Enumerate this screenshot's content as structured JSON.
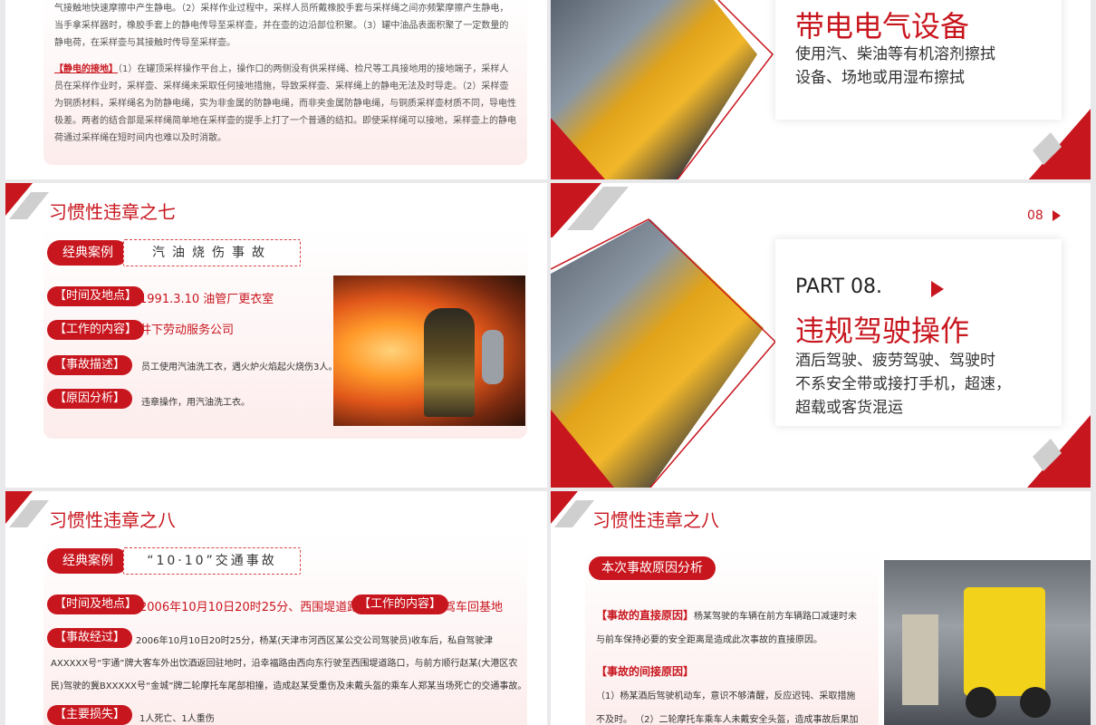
{
  "slide_tl": {
    "para1": "气接触地快速摩擦中产生静电。（2）采样作业过程中，采样人员所戴橡胶手套与采样绳之间亦频繁摩擦产生静电，当手拿采样器时，橡胶手套上的静电传导至采样壶，并在壶的边沿部位积聚。（3）罐中油品表面积聚了一定数量的静电荷，在采样壶与其接触时传导至采样壶。",
    "para2_label": "【静电的接地】",
    "para2": "（1）在罐顶采样操作平台上，操作口的两侧没有供采样绳、检尺等工具接地用的接地端子，采样人员在采样作业时，采样壶、采样绳未采取任何接地措施，导致采样壶、采样绳上的静电无法及时导走。（2）采样壶为铜质材料，采样绳名为防静电绳，实为非金属的防静电绳，而非夹金属防静电绳，与铜质采样壶材质不同，导电性极差。两者的结合部是采样绳简单地在采样壶的提手上打了一个普通的结扣。即使采样绳可以接地，采样壶上的静电荷通过采样绳在短时间内也难以及时消散。"
  },
  "slide_tr": {
    "heading": "带电电气设备",
    "line1": "使用汽、柴油等有机溶剂擦拭",
    "line2": "设备、场地或用湿布擦拭"
  },
  "slide_ml": {
    "title": "习惯性违章之七",
    "case_pill": "经典案例",
    "case_name": "汽油烧伤事故",
    "rows": [
      {
        "label": "【时间及地点】",
        "value": "1991.3.10  油管厂更衣室"
      },
      {
        "label": "【工作的内容】",
        "value": "井下劳动服务公司"
      },
      {
        "label": "【事故描述】",
        "value": "员工使用汽油洗工衣，遇火炉火焰起火烧伤3人。"
      },
      {
        "label": "【原因分析】",
        "value": "违章操作，用汽油洗工衣。"
      }
    ]
  },
  "slide_mr": {
    "page_num": "08",
    "part": "PART 08.",
    "heading": "违规驾驶操作",
    "line1": "酒后驾驶、疲劳驾驶、驾驶时",
    "line2": "不系安全带或接打手机，超速，",
    "line3": "超载或客货混运"
  },
  "slide_bl": {
    "title": "习惯性违章之八",
    "case_pill": "经典案例",
    "case_name": "“10·10”交通事故",
    "time_label": "【时间及地点】",
    "time_value": "2006年10月10日20时25分、西围堤道路口",
    "work_label": "【工作的内容】",
    "work_value": "驾车回基地",
    "process_label": "【事故经过】",
    "process_text": "2006年10月10日20时25分，杨某(天津市河西区某公交公司驾驶员)收车后，私自驾驶津AXXXXX号“宇通”牌大客车外出饮酒返回驻地时，沿幸福路由西向东行驶至西围堤道路口，与前方顺行赵某(大港区农民)驾驶的冀BXXXXX号“金城”牌二轮摩托车尾部相撞，造成赵某受重伤及未戴头盔的乘车人郑某当场死亡的交通事故。",
    "loss_label": "【主要损失】",
    "loss_value": "1人死亡、1人重伤"
  },
  "slide_br": {
    "title": "习惯性违章之八",
    "pill": "本次事故原因分析",
    "direct_label": "【事故的直接原因】",
    "direct_text": "杨某驾驶的车辆在前方车辆路口减速时未与前车保持必要的安全距离是造成此次事故的直接原因。",
    "indirect_label": "【事故的间接原因】",
    "indirect_text": "（1）杨某酒后驾驶机动车，意识不够清醒，反应迟钝、采取措施不及时。 （2）二轮摩托车乘车人未戴安全头盔，造成事故后果加"
  },
  "colors": {
    "accent": "#c8161e",
    "gray": "#cfcfcf"
  }
}
